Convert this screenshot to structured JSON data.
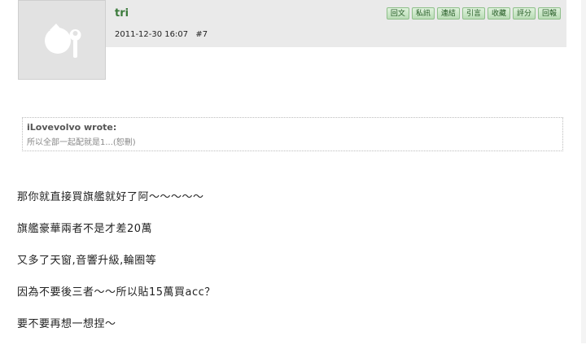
{
  "post": {
    "username": "tri",
    "date": "2011-12-30 16:07",
    "number": "#7",
    "actions": [
      "回文",
      "私訊",
      "連結",
      "引言",
      "收藏",
      "評分",
      "回報"
    ]
  },
  "quote": {
    "author": "iLovevolvo wrote:",
    "text": "所以全部一起配就是1...(恕刪)"
  },
  "content": [
    "那你就直接買旗艦就好了阿～～～～～",
    "旗艦豪華兩者不是才差20萬",
    "又多了天窗,音響升級,輪圈等",
    "因為不要後三者～～所以貼15萬買acc？",
    "要不要再想一想捏～"
  ]
}
